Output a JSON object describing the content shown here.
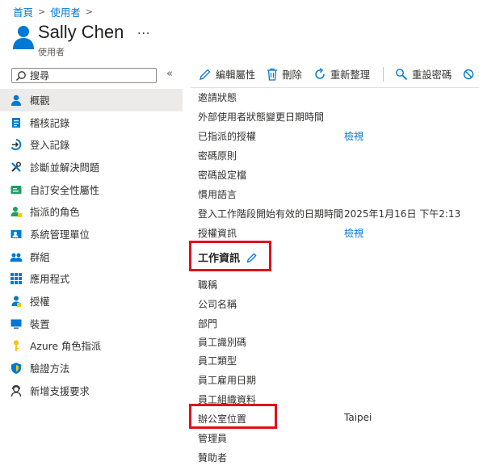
{
  "breadcrumb": {
    "home": "首頁",
    "users": "使用者"
  },
  "header": {
    "title": "Sally Chen",
    "more": "···",
    "subtitle": "使用者"
  },
  "search": {
    "placeholder": "搜尋"
  },
  "sidebar": {
    "items": [
      {
        "label": "概觀",
        "icon": "user-icon"
      },
      {
        "label": "稽核記錄",
        "icon": "audit-log-icon"
      },
      {
        "label": "登入記錄",
        "icon": "sign-in-icon"
      },
      {
        "label": "診斷並解決問題",
        "icon": "wrench-icon"
      },
      {
        "label": "自訂安全性屬性",
        "icon": "security-attribute-icon"
      },
      {
        "label": "指派的角色",
        "icon": "roles-icon"
      },
      {
        "label": "系統管理單位",
        "icon": "admin-unit-icon"
      },
      {
        "label": "群組",
        "icon": "group-icon"
      },
      {
        "label": "應用程式",
        "icon": "apps-grid-icon"
      },
      {
        "label": "授權",
        "icon": "license-icon"
      },
      {
        "label": "裝置",
        "icon": "device-icon"
      },
      {
        "label": "Azure 角色指派",
        "icon": "key-icon"
      },
      {
        "label": "驗證方法",
        "icon": "shield-icon"
      },
      {
        "label": "新增支援要求",
        "icon": "support-icon"
      }
    ]
  },
  "toolbar": {
    "edit": "編輯屬性",
    "delete": "刪除",
    "refresh": "重新整理",
    "reset_password": "重設密碼",
    "more_partial": "撤"
  },
  "properties": [
    {
      "label": "邀請狀態",
      "value": ""
    },
    {
      "label": "外部使用者狀態變更日期時間",
      "value": ""
    },
    {
      "label": "已指派的授權",
      "value": "檢視"
    },
    {
      "label": "密碼原則",
      "value": ""
    },
    {
      "label": "密碼設定檔",
      "value": ""
    },
    {
      "label": "慣用語言",
      "value": ""
    },
    {
      "label": "登入工作階段開始有效的日期時間",
      "value": "2025年1月16日 下午2:13"
    },
    {
      "label": "授權資訊",
      "value": "檢視"
    }
  ],
  "job_section": {
    "title": "工作資訊"
  },
  "job_properties": [
    {
      "label": "職稱",
      "value": ""
    },
    {
      "label": "公司名稱",
      "value": ""
    },
    {
      "label": "部門",
      "value": ""
    },
    {
      "label": "員工識別碼",
      "value": ""
    },
    {
      "label": "員工類型",
      "value": ""
    },
    {
      "label": "員工雇用日期",
      "value": ""
    },
    {
      "label": "員工組織資料",
      "value": ""
    },
    {
      "label": "辦公室位置",
      "value": "Taipei"
    },
    {
      "label": "管理員",
      "value": ""
    },
    {
      "label": "贊助者",
      "value": ""
    }
  ],
  "colors": {
    "accent": "#0078d4",
    "highlight": "#e0111b"
  }
}
